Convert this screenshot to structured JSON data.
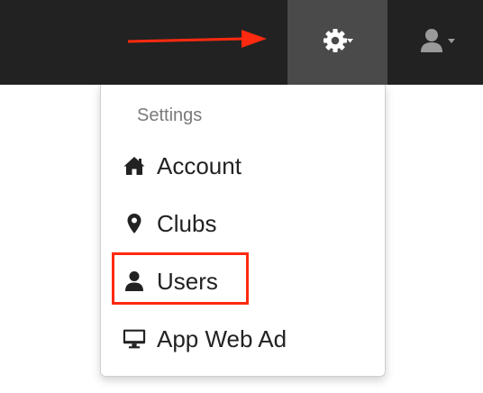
{
  "topbar": {
    "settings_icon": "gear-icon",
    "user_icon": "user-icon"
  },
  "dropdown": {
    "header": "Settings",
    "items": [
      {
        "label": "Account",
        "icon": "home-icon"
      },
      {
        "label": "Clubs",
        "icon": "map-marker-icon"
      },
      {
        "label": "Users",
        "icon": "user-icon"
      },
      {
        "label": "App Web Ad",
        "icon": "desktop-icon"
      }
    ]
  },
  "colors": {
    "topbar": "#222222",
    "active_button": "#4a4a4a",
    "annotation": "#ff2a0f"
  }
}
